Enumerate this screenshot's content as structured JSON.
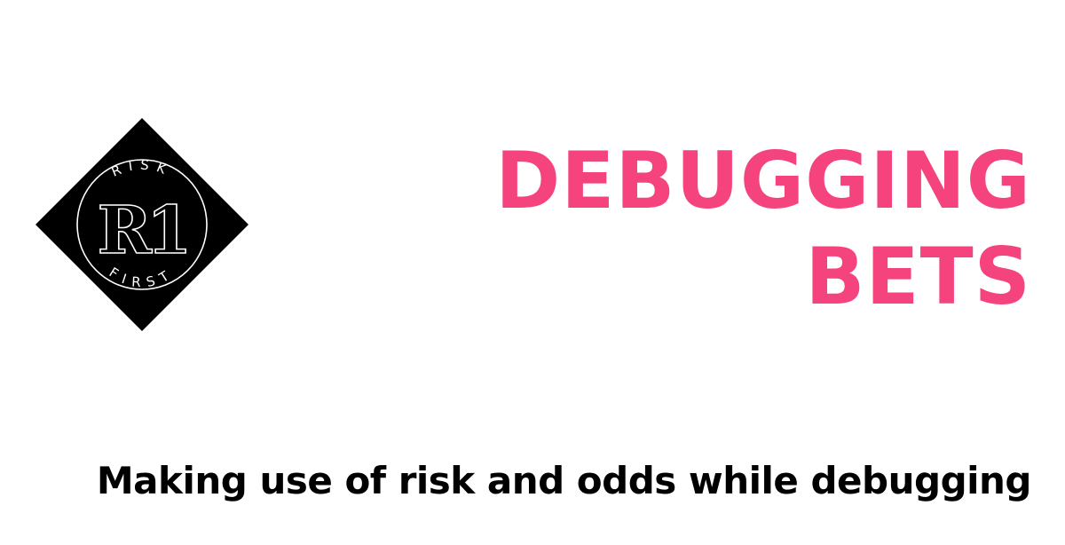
{
  "logo": {
    "top_text": "RISK",
    "bottom_text": "FIRST",
    "monogram": "R1"
  },
  "title": {
    "line1": "DEBUGGING",
    "line2": "BETS"
  },
  "subtitle": "Making use of risk and odds while debugging",
  "colors": {
    "title": "#f5447d",
    "subtitle": "#000000",
    "logo_background": "#000000",
    "logo_foreground": "#ffffff"
  }
}
